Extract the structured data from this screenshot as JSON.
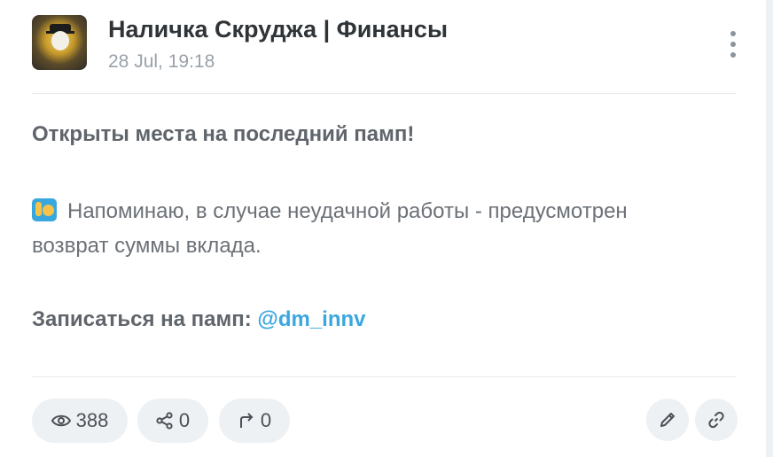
{
  "post": {
    "channel_name": "Наличка Скруджа | Финансы",
    "timestamp": "28 Jul, 19:18",
    "line1": "Открыты места на последний памп!",
    "line2": "Напоминаю, в случае неудачной работы - предусмотрен",
    "line3": "возврат суммы вклада.",
    "line4_prefix": "Записаться на памп: ",
    "line4_link": "@dm_innv"
  },
  "stats": {
    "views": "388",
    "shares": "0",
    "forwards": "0"
  },
  "icons": {
    "menu": "more-vertical-icon",
    "views": "eye-icon",
    "shares": "share-icon",
    "forwards": "forward-arrow-icon",
    "edit": "pencil-icon",
    "link": "link-icon",
    "emoji": "raising-hand-emoji"
  },
  "colors": {
    "link": "#3aa7e0",
    "pill_bg": "#eef1f4"
  }
}
